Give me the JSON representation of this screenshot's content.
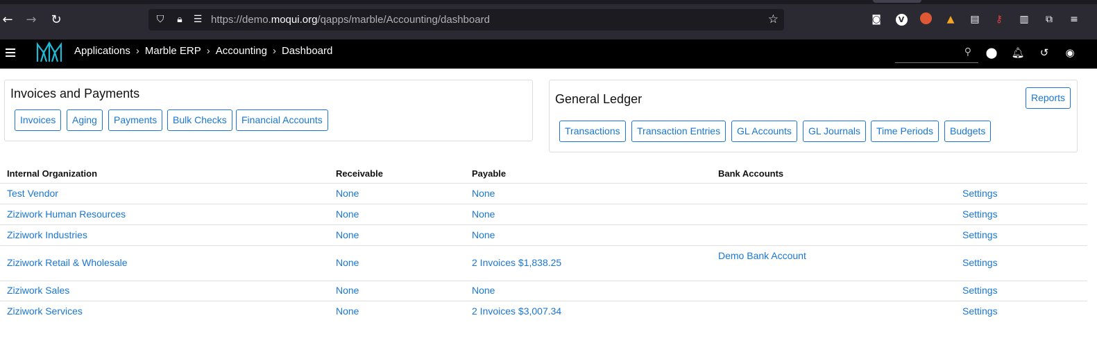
{
  "browser": {
    "url_prefix": "https://demo.",
    "url_domain": "moqui.org",
    "url_path": "/qapps/marble/Accounting/dashboard"
  },
  "header": {
    "breadcrumbs": [
      "Applications",
      "Marble ERP",
      "Accounting",
      "Dashboard"
    ],
    "brand_color": "#1fbad6"
  },
  "invoices_panel": {
    "title": "Invoices and Payments",
    "buttons": [
      "Invoices",
      "Aging",
      "Payments",
      "Bulk Checks",
      "Financial Accounts"
    ]
  },
  "gl_panel": {
    "title": "General Ledger",
    "reports_label": "Reports",
    "buttons": [
      "Transactions",
      "Transaction Entries",
      "GL Accounts",
      "GL Journals",
      "Time Periods",
      "Budgets"
    ]
  },
  "table": {
    "columns": [
      "Internal Organization",
      "Receivable",
      "Payable",
      "Bank Accounts"
    ],
    "rows": [
      {
        "org": "Test Vendor",
        "receivable": "None",
        "payable": "None",
        "bank": "",
        "settings": "Settings"
      },
      {
        "org": "Ziziwork Human Resources",
        "receivable": "None",
        "payable": "None",
        "bank": "",
        "settings": "Settings"
      },
      {
        "org": "Ziziwork Industries",
        "receivable": "None",
        "payable": "None",
        "bank": "",
        "settings": "Settings"
      },
      {
        "org": "Ziziwork Retail & Wholesale",
        "receivable": "None",
        "payable": "2 Invoices $1,838.25",
        "bank": "Demo Bank Account",
        "settings": "Settings"
      },
      {
        "org": "Ziziwork Sales",
        "receivable": "None",
        "payable": "None",
        "bank": "",
        "settings": "Settings"
      },
      {
        "org": "Ziziwork Services",
        "receivable": "None",
        "payable": "2 Invoices $3,007.34",
        "bank": "",
        "settings": "Settings"
      }
    ]
  },
  "colors": {
    "link": "#1976d2",
    "header_bg": "#000000",
    "browser_bg": "#2b2a33"
  }
}
